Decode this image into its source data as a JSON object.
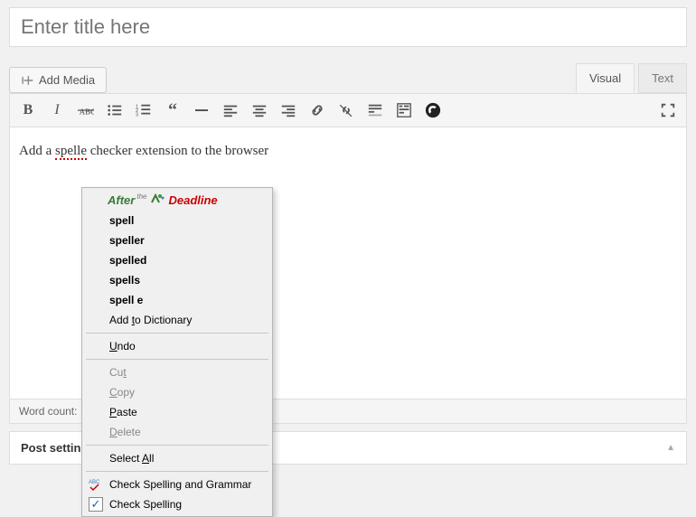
{
  "title": {
    "placeholder": "Enter title here",
    "value": ""
  },
  "media_button": "Add Media",
  "tabs": {
    "visual": "Visual",
    "text": "Text"
  },
  "content": {
    "before": "Add a ",
    "misspelled": "spelle",
    "after": " checker extension to the browser"
  },
  "word_count_label": "Word count:",
  "post_settings_label": "Post settin",
  "context_menu": {
    "brand": {
      "after": "After",
      "the": "the",
      "deadline": "Deadline"
    },
    "suggestions": [
      "spell",
      "speller",
      "spelled",
      "spells",
      "spell e"
    ],
    "add_dict": {
      "pre": "Add ",
      "u": "t",
      "post": "o Dictionary"
    },
    "undo": {
      "u": "U",
      "post": "ndo"
    },
    "cut": {
      "pre": "Cu",
      "u": "t",
      "post": ""
    },
    "copy": {
      "u": "C",
      "post": "opy"
    },
    "paste": {
      "u": "P",
      "post": "aste"
    },
    "delete": {
      "u": "D",
      "post": "elete"
    },
    "select_all": {
      "pre": "Select ",
      "u": "A",
      "post": "ll"
    },
    "check_sg": "Check Spelling and Grammar",
    "check_s": "Check Spelling"
  }
}
